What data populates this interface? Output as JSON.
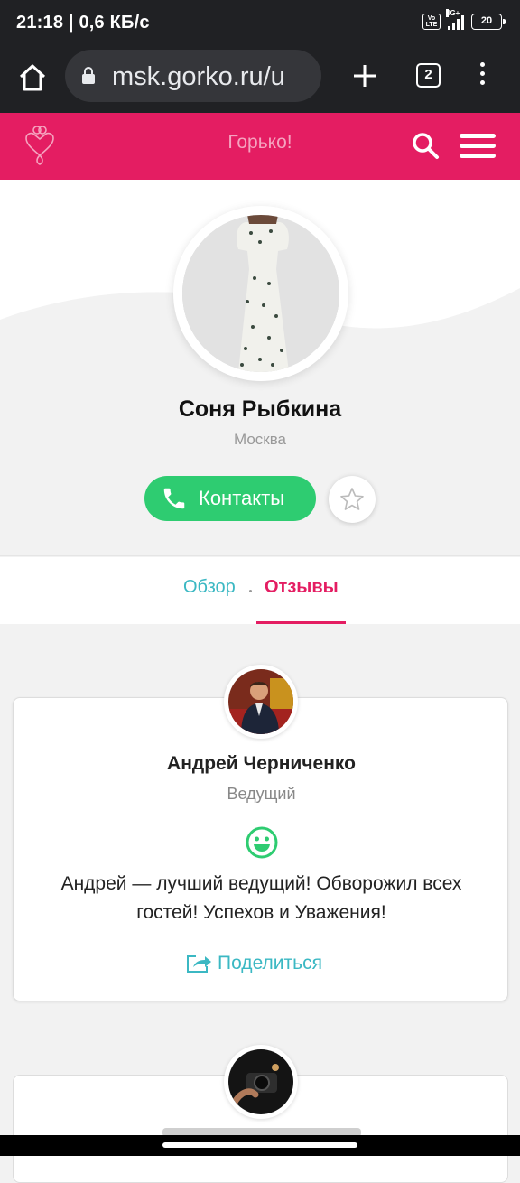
{
  "status_bar": {
    "time_speed": "21:18 | 0,6 КБ/с",
    "volte": "Vo LTE",
    "network": "4G+",
    "battery": "20"
  },
  "browser": {
    "url": "msk.gorko.ru/u",
    "tab_count": "2"
  },
  "site": {
    "title": "Горько!",
    "accent": "#e41d62"
  },
  "profile": {
    "name": "Соня Рыбкина",
    "city": "Москва",
    "contacts_label": "Контакты"
  },
  "tabs": [
    {
      "label": "Обзор",
      "active": false
    },
    {
      "label": "Отзывы",
      "active": true
    }
  ],
  "reviews": [
    {
      "name": "Андрей Черниченко",
      "role": "Ведущий",
      "text": "Андрей — лучший ведущий! Обворожил всех гостей! Успехов и Уважения!",
      "share_label": "Поделиться",
      "sentiment_icon": "smiley-icon"
    }
  ],
  "colors": {
    "green": "#2ecc71",
    "teal": "#3bb8c3",
    "pink": "#e41d62"
  }
}
